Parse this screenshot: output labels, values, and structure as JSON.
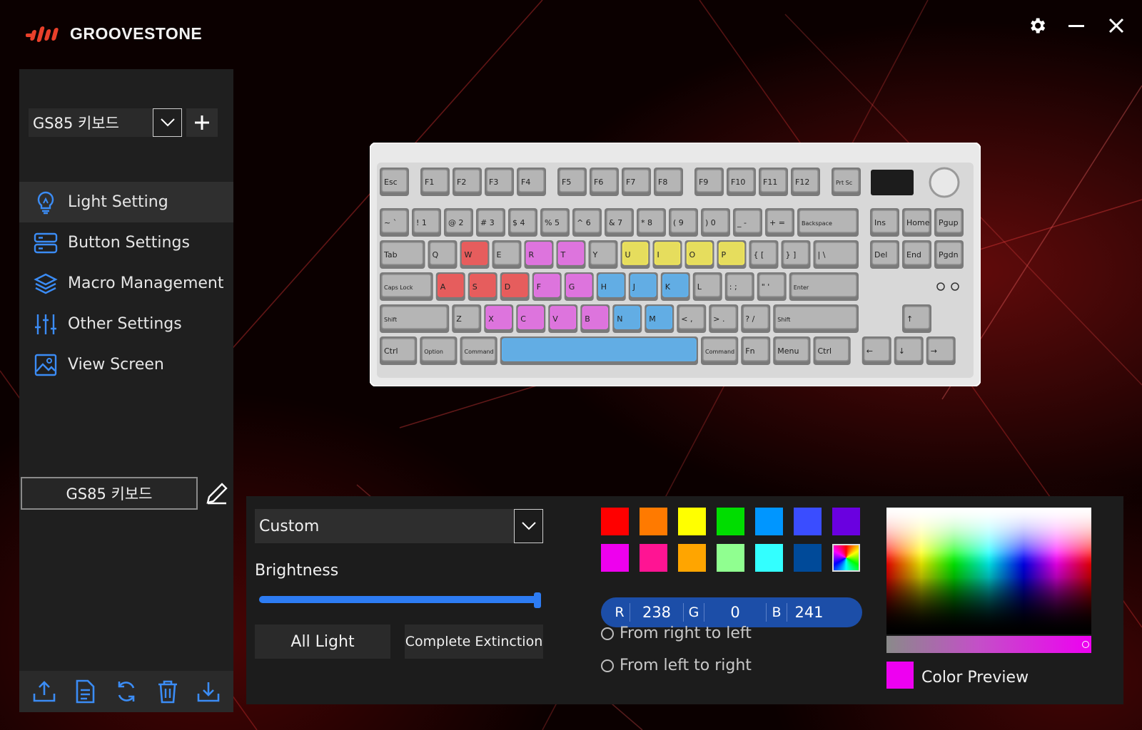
{
  "app": {
    "brand": "GROOVESTONE"
  },
  "sidebar": {
    "device": "GS85 키보드",
    "menu": [
      {
        "label": "Light Setting",
        "icon": "bulb-icon",
        "active": true
      },
      {
        "label": "Button Settings",
        "icon": "server-icon",
        "active": false
      },
      {
        "label": "Macro Management",
        "icon": "layers-icon",
        "active": false
      },
      {
        "label": "Other Settings",
        "icon": "sliders-icon",
        "active": false
      },
      {
        "label": "View Screen",
        "icon": "image-icon",
        "active": false
      }
    ],
    "profile": "GS85 키보드",
    "bottom_icons": [
      "upload-icon",
      "document-icon",
      "sync-icon",
      "trash-icon",
      "download-icon"
    ]
  },
  "keyboard": {
    "rows": [
      [
        {
          "l": "Esc"
        },
        {
          "l": "F1"
        },
        {
          "l": "F2"
        },
        {
          "l": "F3"
        },
        {
          "l": "F4"
        },
        {
          "l": "F5"
        },
        {
          "l": "F6"
        },
        {
          "l": "F7"
        },
        {
          "l": "F8"
        },
        {
          "l": "F9"
        },
        {
          "l": "F10"
        },
        {
          "l": "F11"
        },
        {
          "l": "F12"
        },
        {
          "l": "Prt Sc"
        }
      ],
      [
        {
          "l": "~ `"
        },
        {
          "l": "! 1"
        },
        {
          "l": "@ 2"
        },
        {
          "l": "# 3"
        },
        {
          "l": "$ 4"
        },
        {
          "l": "% 5"
        },
        {
          "l": "^ 6"
        },
        {
          "l": "& 7"
        },
        {
          "l": "* 8"
        },
        {
          "l": "( 9"
        },
        {
          "l": ") 0"
        },
        {
          "l": "_ -"
        },
        {
          "l": "+ ="
        },
        {
          "l": "Backspace"
        },
        {
          "l": "Ins"
        },
        {
          "l": "Home"
        },
        {
          "l": "Pgup"
        }
      ],
      [
        {
          "l": "Tab"
        },
        {
          "l": "Q"
        },
        {
          "l": "W",
          "c": "red"
        },
        {
          "l": "E"
        },
        {
          "l": "R",
          "c": "magenta"
        },
        {
          "l": "T",
          "c": "magenta"
        },
        {
          "l": "Y"
        },
        {
          "l": "U",
          "c": "yellow"
        },
        {
          "l": "I",
          "c": "yellow"
        },
        {
          "l": "O",
          "c": "yellow"
        },
        {
          "l": "P",
          "c": "yellow"
        },
        {
          "l": "{ ["
        },
        {
          "l": "} ]"
        },
        {
          "l": "| \\"
        },
        {
          "l": "Del"
        },
        {
          "l": "End"
        },
        {
          "l": "Pgdn"
        }
      ],
      [
        {
          "l": "Caps Lock"
        },
        {
          "l": "A",
          "c": "red"
        },
        {
          "l": "S",
          "c": "red"
        },
        {
          "l": "D",
          "c": "red"
        },
        {
          "l": "F",
          "c": "magenta"
        },
        {
          "l": "G",
          "c": "magenta"
        },
        {
          "l": "H",
          "c": "blue"
        },
        {
          "l": "J",
          "c": "blue"
        },
        {
          "l": "K",
          "c": "blue"
        },
        {
          "l": "L"
        },
        {
          "l": ": ;"
        },
        {
          "l": "\" '"
        },
        {
          "l": "Enter"
        }
      ],
      [
        {
          "l": "Shift"
        },
        {
          "l": "Z"
        },
        {
          "l": "X",
          "c": "magenta"
        },
        {
          "l": "C",
          "c": "magenta"
        },
        {
          "l": "V",
          "c": "magenta"
        },
        {
          "l": "B",
          "c": "magenta"
        },
        {
          "l": "N",
          "c": "blue"
        },
        {
          "l": "M",
          "c": "blue"
        },
        {
          "l": "< ,"
        },
        {
          "l": "> ."
        },
        {
          "l": "? /"
        },
        {
          "l": "Shift"
        },
        {
          "l": "↑"
        }
      ],
      [
        {
          "l": "Ctrl"
        },
        {
          "l": "Option"
        },
        {
          "l": "Command"
        },
        {
          "l": "",
          "c": "blue"
        },
        {
          "l": "Command"
        },
        {
          "l": "Fn"
        },
        {
          "l": "Menu"
        },
        {
          "l": "Ctrl"
        },
        {
          "l": "←"
        },
        {
          "l": "↓"
        },
        {
          "l": "→"
        }
      ]
    ],
    "highlight_colors": {
      "red": "#f25a5a",
      "magenta": "#e873e8",
      "yellow": "#f2e85a",
      "blue": "#5fb3f0"
    }
  },
  "light": {
    "mode": "Custom",
    "brightness_label": "Brightness",
    "brightness": 1.0,
    "all_light": "All Light",
    "complete_extinction": "Complete Extinction",
    "swatches": [
      "#ff0000",
      "#ff7a00",
      "#ffff00",
      "#00dd00",
      "#0096ff",
      "#3a4dff",
      "#6a00e0",
      "#ee00ee",
      "#ff1493",
      "#ffa500",
      "#90ff90",
      "#33ffff",
      "#004a99",
      "rainbow"
    ],
    "rgb": {
      "r_label": "R",
      "r": "238",
      "g_label": "G",
      "g": "0",
      "b_label": "B",
      "b": "241"
    },
    "direction_rtl": "From right to left",
    "direction_ltr": "From left to right",
    "preview_label": "Color Preview",
    "preview_color": "#ee00f1"
  }
}
